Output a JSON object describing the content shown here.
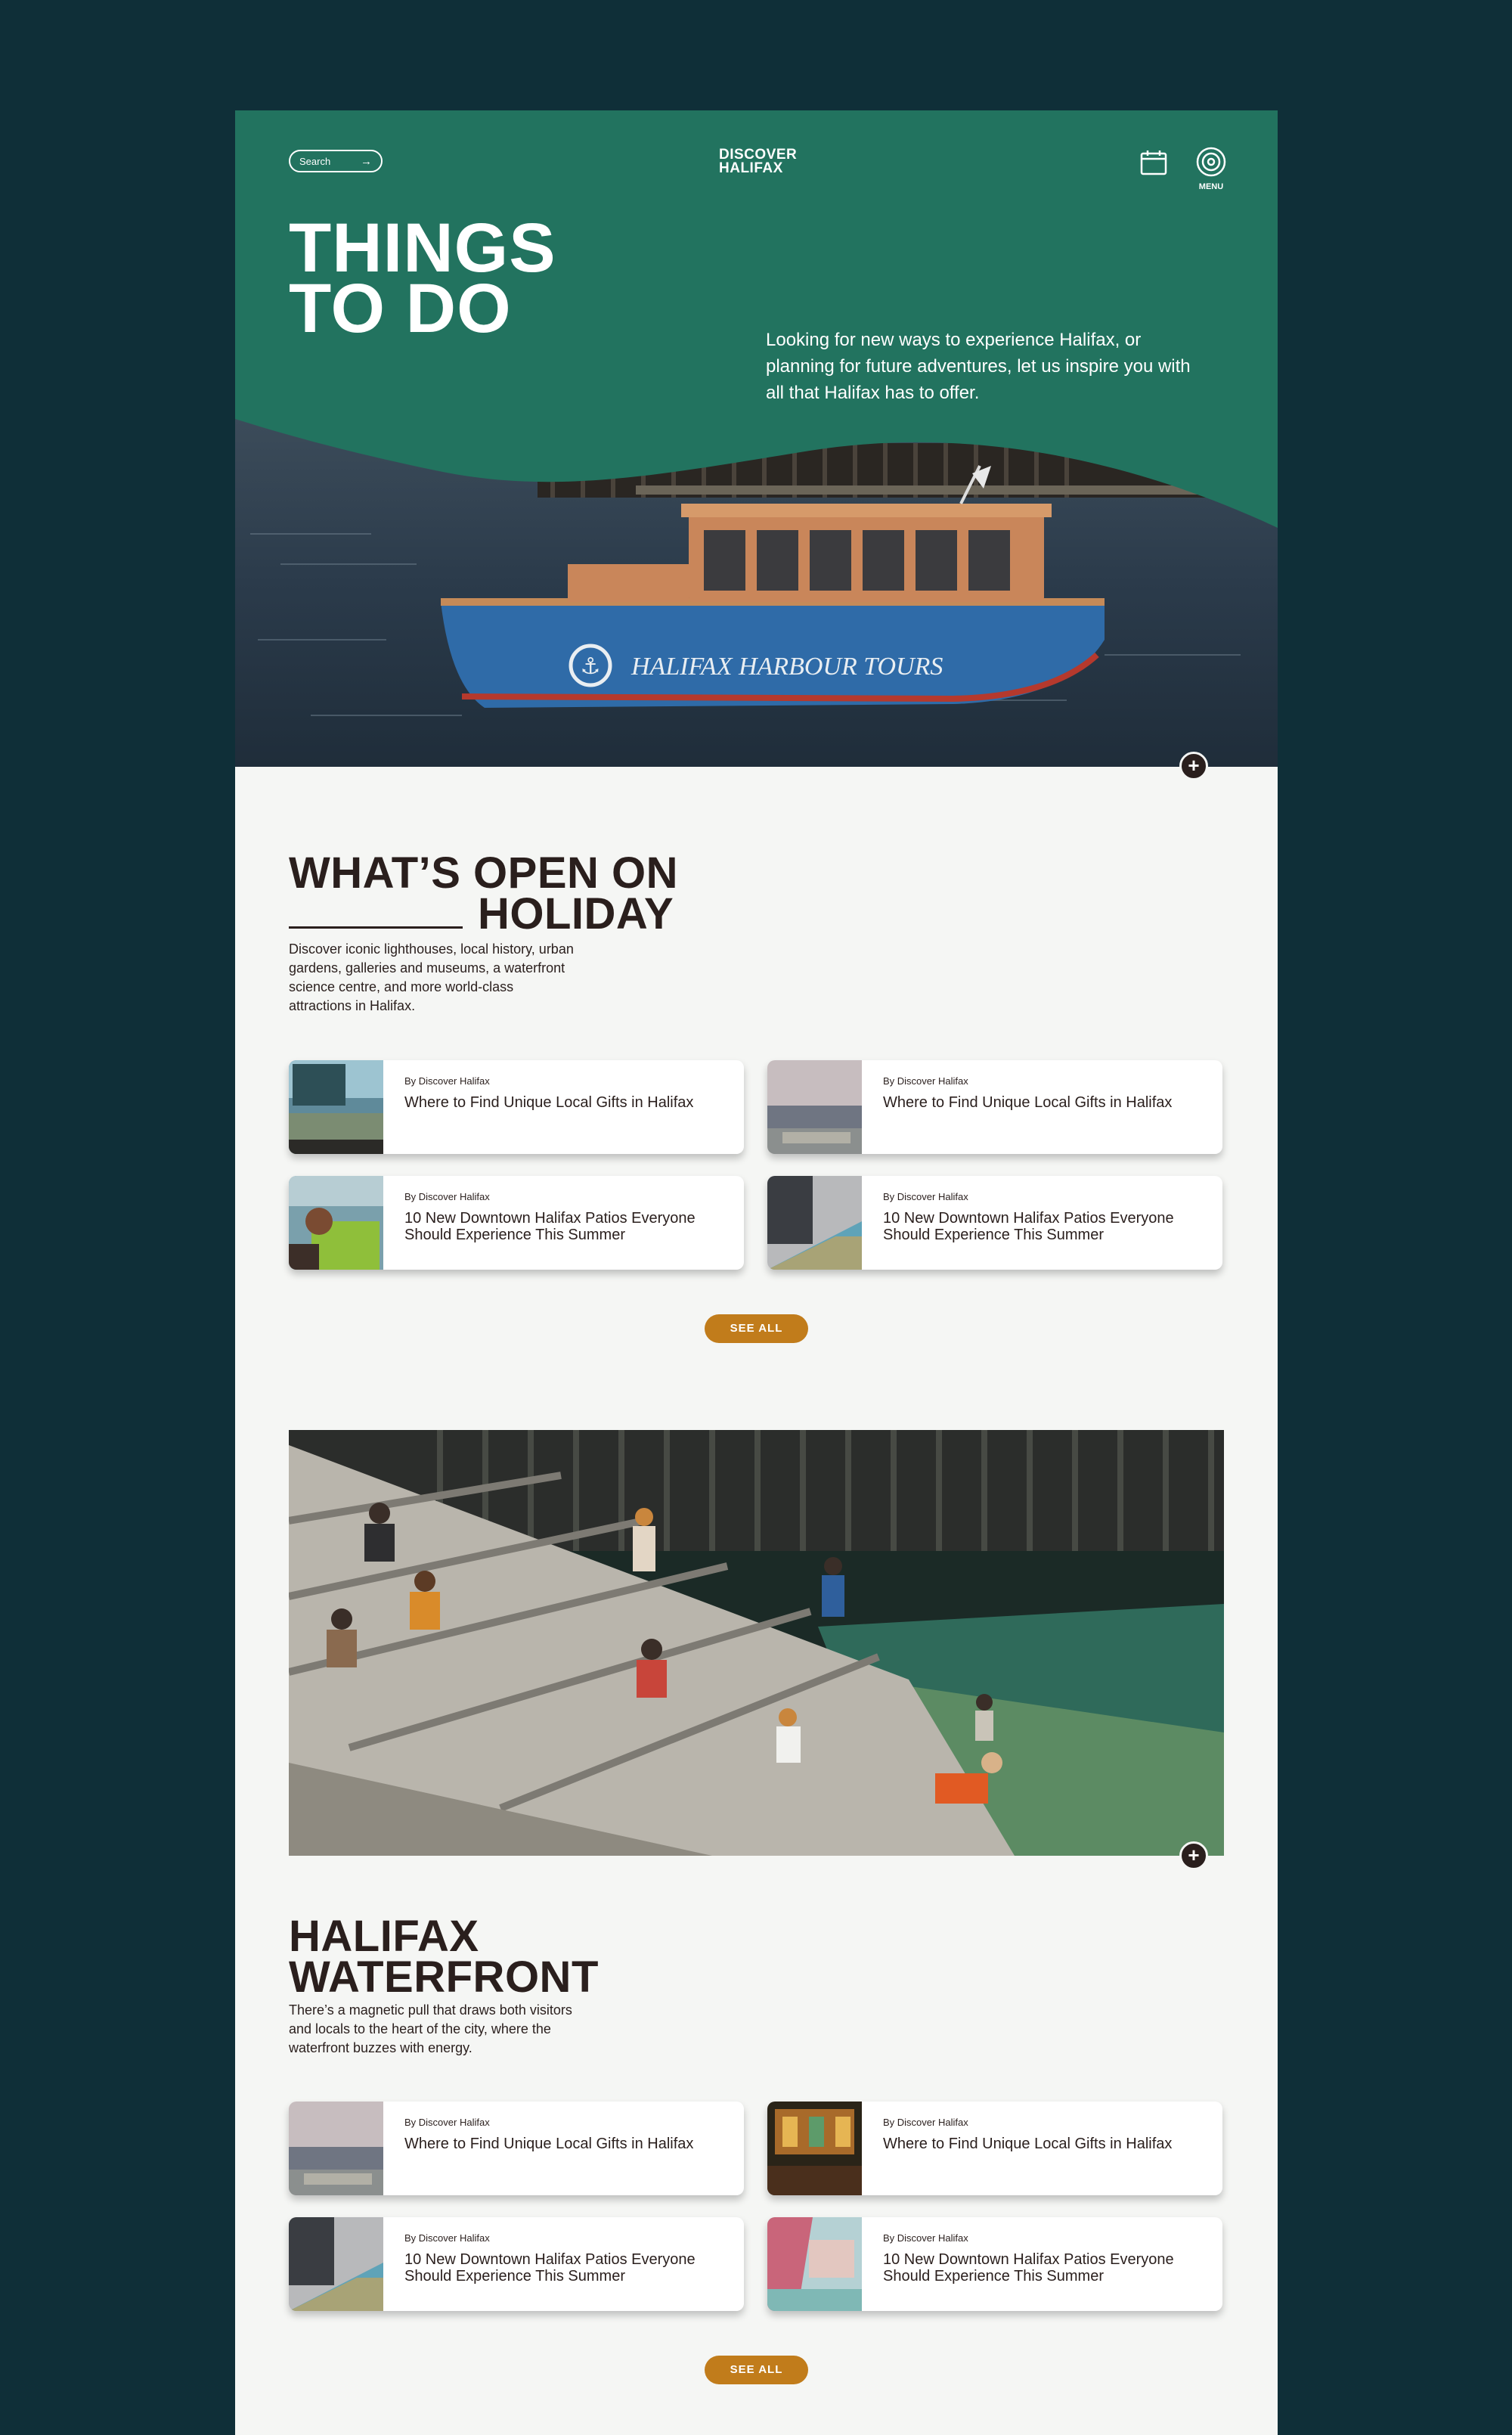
{
  "header": {
    "search_label": "Search",
    "logo_line1": "DISCOVER",
    "logo_line2": "HALIFAX",
    "menu_label": "MENU"
  },
  "hero": {
    "title_line1": "THINGS",
    "title_line2": "TO DO",
    "description": "Looking for new ways to experience Halifax, or planning for future adventures, let us inspire you with all that Halifax has to offer.",
    "boat_text": "HALIFAX HARBOUR TOURS"
  },
  "section_holiday": {
    "title_line1": "WHAT’S OPEN ON",
    "title_line2": "HOLIDAY",
    "description": "Discover iconic lighthouses, local history, urban gardens, galleries and museums, a waterfront science centre, and more world-class attractions in Halifax.",
    "cards": [
      {
        "by": "By Discover Halifax",
        "title": "Where to Find Unique Local Gifts in Halifax"
      },
      {
        "by": "By Discover Halifax",
        "title": "Where to Find Unique Local Gifts in Halifax"
      },
      {
        "by": "By Discover Halifax",
        "title": "10 New Downtown Halifax Patios Everyone Should Experience This Summer"
      },
      {
        "by": "By Discover Halifax",
        "title": "10 New Downtown Halifax Patios Everyone Should Experience This Summer"
      }
    ],
    "see_all": "SEE ALL"
  },
  "section_waterfront": {
    "title_line1": "HALIFAX",
    "title_line2": "WATERFRONT",
    "description": "There’s a magnetic pull that draws both visitors and locals to the heart of the city, where the waterfront buzzes with energy.",
    "cards": [
      {
        "by": "By Discover Halifax",
        "title": "Where to Find Unique Local Gifts in Halifax"
      },
      {
        "by": "By Discover Halifax",
        "title": "Where to Find Unique Local Gifts in Halifax"
      },
      {
        "by": "By Discover Halifax",
        "title": "10 New Downtown Halifax Patios Everyone Should Experience This Summer"
      },
      {
        "by": "By Discover Halifax",
        "title": "10 New Downtown Halifax Patios Everyone Should Experience This Summer"
      }
    ],
    "see_all": "SEE ALL"
  },
  "colors": {
    "background": "#0f2f38",
    "hero_green": "#22735f",
    "page": "#f5f6f4",
    "text_dark": "#2a1f1d",
    "accent_gold": "#c17c1b"
  },
  "icons": [
    "arrow-right-icon",
    "calendar-icon",
    "menu-target-icon",
    "plus-icon"
  ]
}
